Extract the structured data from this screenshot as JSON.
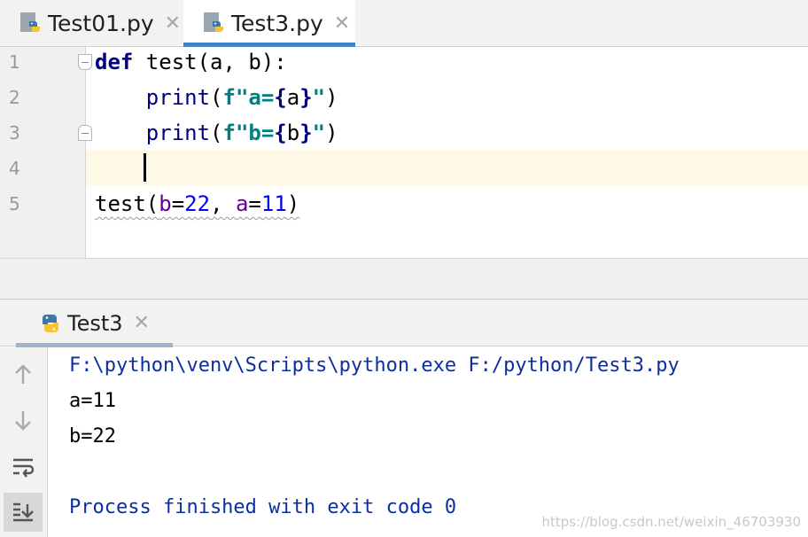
{
  "editor_tabs": [
    {
      "label": "Test01.py",
      "close": "✕",
      "icon": "python-file-icon"
    },
    {
      "label": "Test3.py",
      "close": "✕",
      "icon": "python-file-icon",
      "active": true
    }
  ],
  "line_numbers": [
    "1",
    "2",
    "3",
    "4",
    "5"
  ],
  "code": {
    "line1": {
      "keyword": "def",
      "rest": " test(a, b):"
    },
    "line2": {
      "indent": "    ",
      "func": "print",
      "open": "(",
      "prefix": "f\"a=",
      "brace_open": "{",
      "var": "a",
      "brace_close": "}",
      "quote": "\"",
      "close": ")"
    },
    "line3": {
      "indent": "    ",
      "func": "print",
      "open": "(",
      "prefix": "f\"b=",
      "brace_open": "{",
      "var": "b",
      "brace_close": "}",
      "quote": "\"",
      "close": ")"
    },
    "line5": {
      "call": "test(",
      "p1": "b",
      "eq1": "=",
      "v1": "22",
      "sep": ", ",
      "p2": "a",
      "eq2": "=",
      "v2": "11",
      "close": ")"
    }
  },
  "run_tab": {
    "label": "Test3",
    "close": "✕",
    "icon": "python-file-icon"
  },
  "console": {
    "command": "F:\\python\\venv\\Scripts\\python.exe F:/python/Test3.py",
    "out1": "a=11",
    "out2": "b=22",
    "finished": "Process finished with exit code 0"
  },
  "toolbar_icons": [
    "up-arrow-icon",
    "down-arrow-icon",
    "soft-wrap-icon",
    "scroll-to-end-icon"
  ],
  "watermark": "https://blog.csdn.net/weixin_46703930",
  "colors": {
    "keyword": "#000080",
    "fstring": "#008080",
    "param": "#660099",
    "number": "#0000ff",
    "console_system": "#0b2fa0",
    "active_tab_underline": "#4083c9",
    "current_line": "#fdf9e4"
  }
}
